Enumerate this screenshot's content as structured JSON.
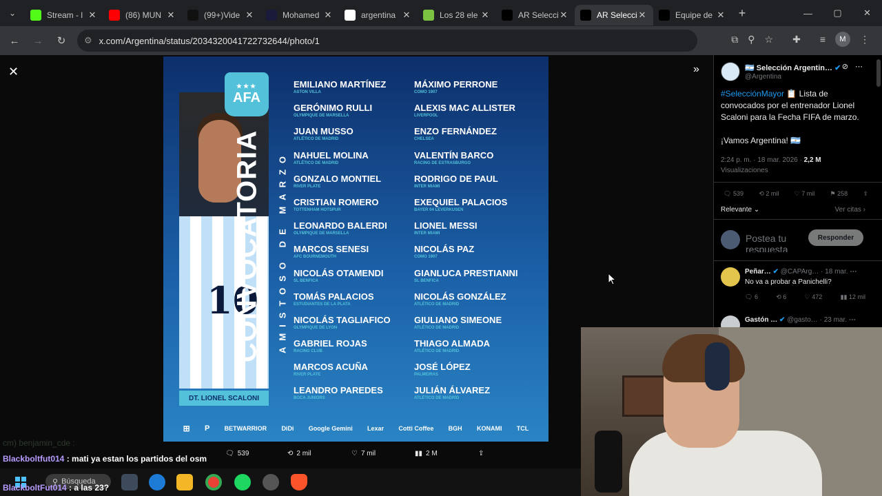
{
  "browser": {
    "tabs": [
      {
        "title": "Stream - l",
        "favicon": "kick-icon",
        "color": "#53fc18"
      },
      {
        "title": "(86) MUN",
        "favicon": "youtube-icon",
        "color": "#ff0000"
      },
      {
        "title": "(99+)Vide",
        "favicon": "tiktok-icon",
        "color": "#111111"
      },
      {
        "title": "Mohamed",
        "favicon": "fm-icon",
        "color": "#1a1a3a"
      },
      {
        "title": "argentina",
        "favicon": "google-icon",
        "color": "#ffffff"
      },
      {
        "title": "Los 28 ele",
        "favicon": "ole-icon",
        "color": "#7cc242"
      },
      {
        "title": "AR Selecci",
        "favicon": "x-icon",
        "color": "#000000"
      },
      {
        "title": "AR Selecci",
        "favicon": "x-icon",
        "color": "#000000"
      },
      {
        "title": "Equipe de",
        "favicon": "x-icon",
        "color": "#000000"
      }
    ],
    "url": "x.com/Argentina/status/2034320041722732644/photo/1",
    "profile_initial": "M"
  },
  "graphic": {
    "afa_text": "AFA",
    "title": "CONVOCATORIA",
    "subtitle": "AMISTOSO DE MARZO",
    "coach": "DT. LIONEL SCALONI",
    "jersey_number": "10",
    "col1": [
      {
        "name": "EMILIANO MARTÍNEZ",
        "club": "ASTON VILLA"
      },
      {
        "name": "GERÓNIMO RULLI",
        "club": "OLYMPIQUE DE MARSELLA"
      },
      {
        "name": "JUAN MUSSO",
        "club": "ATLÉTICO DE MADRID"
      },
      {
        "name": "NAHUEL MOLINA",
        "club": "ATLÉTICO DE MADRID"
      },
      {
        "name": "GONZALO MONTIEL",
        "club": "RIVER PLATE"
      },
      {
        "name": "CRISTIAN ROMERO",
        "club": "TOTTENHAM HOTSPUR"
      },
      {
        "name": "LEONARDO BALERDI",
        "club": "OLYMPIQUE DE MARSELLA"
      },
      {
        "name": "MARCOS SENESI",
        "club": "AFC BOURNEMOUTH"
      },
      {
        "name": "NICOLÁS OTAMENDI",
        "club": "SL BENFICA"
      },
      {
        "name": "TOMÁS PALACIOS",
        "club": "ESTUDIANTES DE LA PLATA"
      },
      {
        "name": "NICOLÁS TAGLIAFICO",
        "club": "OLYMPIQUE DE LYON"
      },
      {
        "name": "GABRIEL ROJAS",
        "club": "RACING CLUB"
      },
      {
        "name": "MARCOS ACUÑA",
        "club": "RIVER PLATE"
      },
      {
        "name": "LEANDRO PAREDES",
        "club": "BOCA JUNIORS"
      }
    ],
    "col2": [
      {
        "name": "MÁXIMO PERRONE",
        "club": "COMO 1907"
      },
      {
        "name": "ALEXIS MAC ALLISTER",
        "club": "LIVERPOOL"
      },
      {
        "name": "ENZO FERNÁNDEZ",
        "club": "CHELSEA"
      },
      {
        "name": "VALENTÍN BARCO",
        "club": "RACING DE ESTRASBURGO"
      },
      {
        "name": "RODRIGO DE PAUL",
        "club": "INTER MIAMI"
      },
      {
        "name": "EXEQUIEL PALACIOS",
        "club": "BAYER 04 LEVERKUSEN"
      },
      {
        "name": "LIONEL MESSI",
        "club": "INTER MIAMI"
      },
      {
        "name": "NICOLÁS PAZ",
        "club": "COMO 1907"
      },
      {
        "name": "GIANLUCA PRESTIANNI",
        "club": "SL BENFICA"
      },
      {
        "name": "NICOLÁS GONZÁLEZ",
        "club": "ATLÉTICO DE MADRID"
      },
      {
        "name": "GIULIANO SIMEONE",
        "club": "ATLÉTICO DE MADRID"
      },
      {
        "name": "THIAGO ALMADA",
        "club": "ATLÉTICO DE MADRID"
      },
      {
        "name": "JOSÉ LÓPEZ",
        "club": "PALMEIRAS"
      },
      {
        "name": "JULIÁN ÁLVAREZ",
        "club": "ATLÉTICO DE MADRID"
      }
    ],
    "sponsors": [
      "BETWARRIOR",
      "DiDi",
      "Google Gemini",
      "Lexar",
      "Cotti Coffee",
      "BGH",
      "KONAMI",
      "TCL"
    ]
  },
  "photo_engagement": {
    "replies": "539",
    "reposts": "2 mil",
    "likes": "7 mil",
    "views": "2 M"
  },
  "sidebar": {
    "account_name": "Selección Argentin…",
    "account_handle": "@Argentina",
    "tweet_hashtag": "#SelecciónMayor",
    "tweet_body": "📋 Lista de convocados por el entrenador Lionel Scaloni para la Fecha FIFA de marzo.",
    "tweet_line2": "¡Vamos Argentina! 🇦🇷",
    "time": "2:24 p. m. · 18 mar. 2026 ·",
    "views": "2,2 M",
    "views_label": "Visualizaciones",
    "actions": {
      "replies": "539",
      "reposts": "2 mil",
      "likes": "7 mil",
      "bookmarks": "258"
    },
    "sort_label": "Relevante",
    "quotes_label": "Ver citas",
    "reply_placeholder": "Postea tu respuesta",
    "reply_button": "Responder",
    "replies": [
      {
        "name": "Peñar…",
        "handle": "@CAPArg… · 18 mar.",
        "text": "No va a probar a Panichelli?",
        "replies": "6",
        "reposts": "6",
        "likes": "472",
        "views": "12 mil"
      },
      {
        "name": "Gastón …",
        "handle": "@gasto… · 23 mar.",
        "text": ""
      }
    ]
  },
  "chat": {
    "faint_line": "cm) benjamin_cde :",
    "messages": [
      {
        "user": "Blackboltfut014",
        "text": ": mati ya estan los partidos del osm"
      },
      {
        "user": "BlackboltFut014",
        "text": ": a las 23?"
      }
    ]
  },
  "taskbar": {
    "search_label": "Búsqueda"
  }
}
